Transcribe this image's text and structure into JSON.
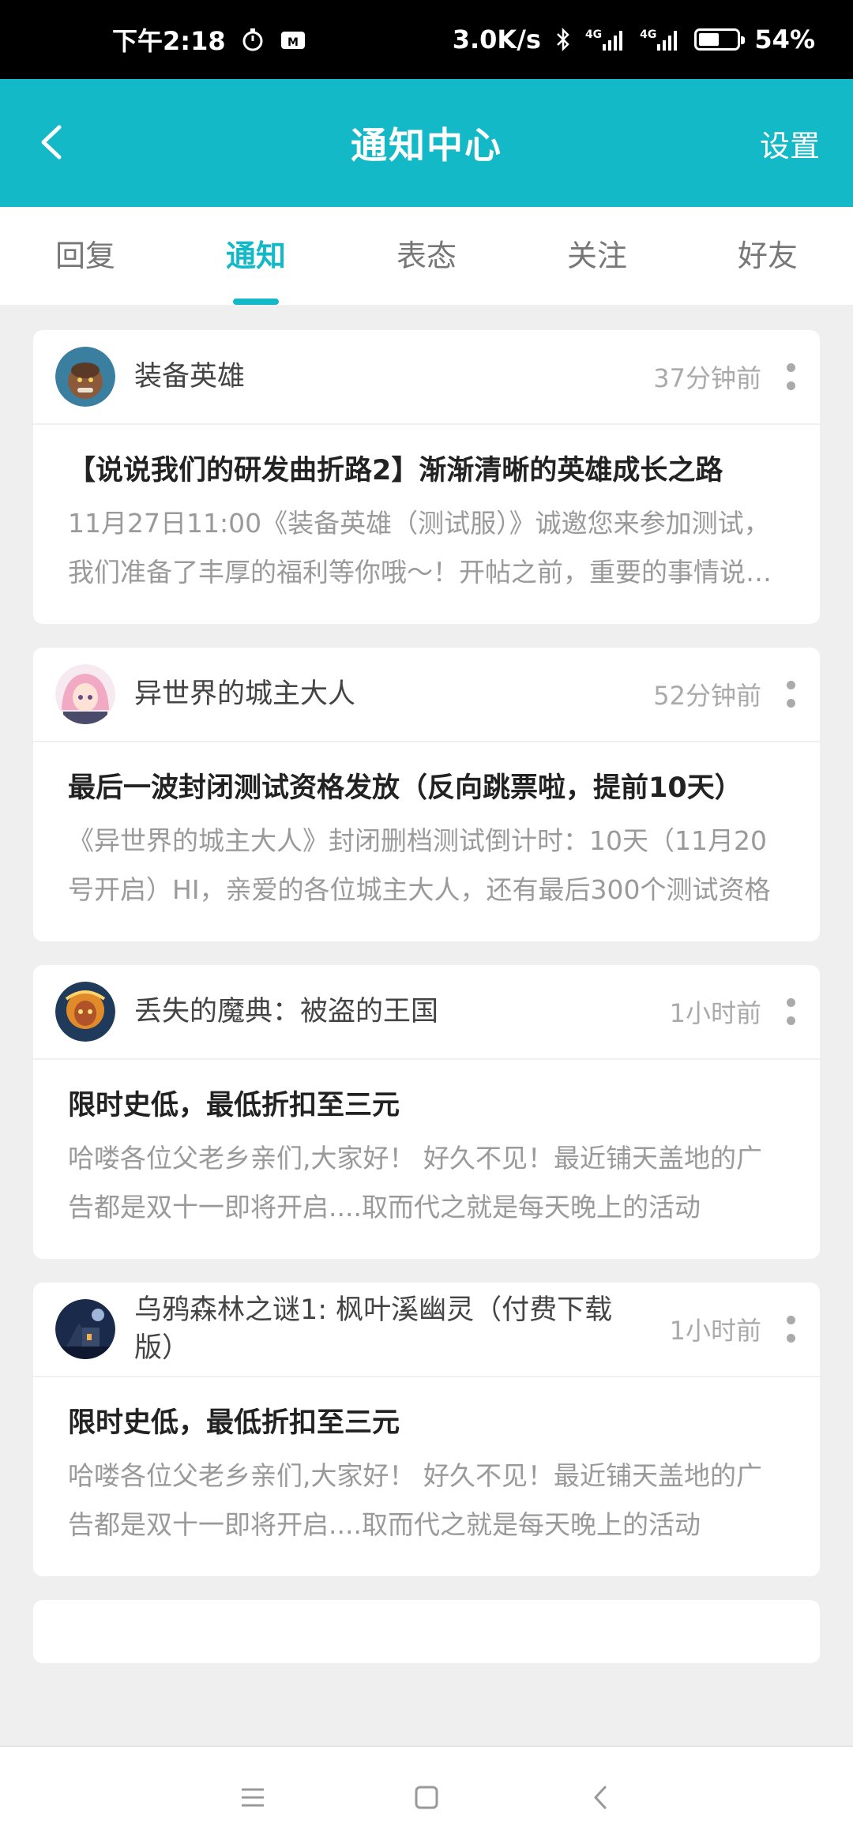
{
  "status_bar": {
    "time": "下午2:18",
    "net_speed": "3.0K/s",
    "signal_1": "4G",
    "signal_2": "4G",
    "battery": "54%",
    "battery_level": 0.54
  },
  "header": {
    "title": "通知中心",
    "settings_label": "设置",
    "accent_color": "#14b9c8"
  },
  "tabs": [
    {
      "label": "回复",
      "active": false
    },
    {
      "label": "通知",
      "active": true
    },
    {
      "label": "表态",
      "active": false
    },
    {
      "label": "关注",
      "active": false
    },
    {
      "label": "好友",
      "active": false
    }
  ],
  "notifications": [
    {
      "game": "装备英雄",
      "time": "37分钟前",
      "title": "【说说我们的研发曲折路2】渐渐清晰的英雄成长之路",
      "excerpt": "11月27日11:00《装备英雄（测试服）》诚邀您来参加测试，我们准备了丰厚的福利等你哦～！开帖之前，重要的事情说三遍"
    },
    {
      "game": "异世界的城主大人",
      "time": "52分钟前",
      "title": "最后一波封闭测试资格发放（反向跳票啦，提前10天）",
      "excerpt": "《异世界的城主大人》封闭删档测试倒计时：10天（11月20号开启）HI，亲爱的各位城主大人，还有最后300个测试资格"
    },
    {
      "game": "丢失的魔典：被盗的王国",
      "time": "1小时前",
      "title": "限时史低，最低折扣至三元",
      "excerpt": "哈喽各位父老乡亲们,大家好！ 好久不见！最近铺天盖地的广告都是双十一即将开启....取而代之就是每天晚上的活动"
    },
    {
      "game": "乌鸦森林之谜1: 枫叶溪幽灵（付费下载版）",
      "time": "1小时前",
      "title": "限时史低，最低折扣至三元",
      "excerpt": "哈喽各位父老乡亲们,大家好！ 好久不见！最近铺天盖地的广告都是双十一即将开启....取而代之就是每天晚上的活动"
    }
  ]
}
